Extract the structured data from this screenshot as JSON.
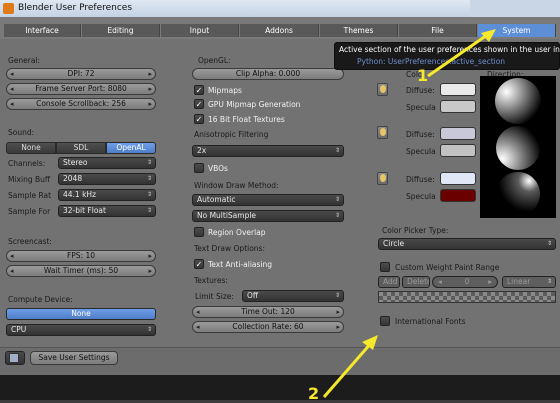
{
  "window": {
    "title": "Blender User Preferences"
  },
  "tabs": [
    {
      "label": "Interface",
      "active": false
    },
    {
      "label": "Editing",
      "active": false
    },
    {
      "label": "Input",
      "active": false
    },
    {
      "label": "Addons",
      "active": false
    },
    {
      "label": "Themes",
      "active": false
    },
    {
      "label": "File",
      "active": false
    },
    {
      "label": "System",
      "active": true
    }
  ],
  "tooltip": {
    "text": "Active section of the user preferences shown in the user interf",
    "python": "Python: UserPreferences.active_section"
  },
  "general": {
    "heading": "General:",
    "dpi": "DPI: 72",
    "frame_server_port": "Frame Server Port: 8080",
    "console_scrollback": "Console Scrollback: 256"
  },
  "sound": {
    "heading": "Sound:",
    "options": [
      "None",
      "SDL",
      "OpenAL"
    ],
    "selected": "OpenAL",
    "channels": {
      "label": "Channels:",
      "value": "Stereo"
    },
    "mixing_buff": {
      "label": "Mixing Buff",
      "value": "2048"
    },
    "sample_rate": {
      "label": "Sample Rat",
      "value": "44.1 kHz"
    },
    "sample_format": {
      "label": "Sample For",
      "value": "32-bit Float"
    }
  },
  "screencast": {
    "heading": "Screencast:",
    "fps": "FPS: 10",
    "wait_timer": "Wait Timer (ms): 50"
  },
  "compute": {
    "heading": "Compute Device:",
    "none_button": "None",
    "device": "CPU"
  },
  "opengl": {
    "heading": "OpenGL:",
    "clip_alpha": "Clip Alpha: 0.000",
    "mipmaps": {
      "label": "Mipmaps",
      "checked": true
    },
    "gpu_mipmap": {
      "label": "GPU Mipmap Generation",
      "checked": true
    },
    "float_textures": {
      "label": "16 Bit Float Textures",
      "checked": true
    },
    "aniso_heading": "Anisotropic Filtering",
    "aniso_value": "2x",
    "vbos": {
      "label": "VBOs",
      "checked": false
    },
    "draw_method_heading": "Window Draw Method:",
    "draw_method": "Automatic",
    "multisample": "No MultiSample",
    "region_overlap": {
      "label": "Region Overlap",
      "checked": false
    },
    "text_draw_heading": "Text Draw Options:",
    "text_antialias": {
      "label": "Text Anti-aliasing",
      "checked": true
    },
    "textures_heading": "Textures:",
    "limit_size_label": "Limit Size:",
    "limit_size_value": "Off",
    "time_out": "Time Out: 120",
    "collection_rate": "Collection Rate: 60"
  },
  "solid_lights": {
    "col_colo": "Colo",
    "col_direction": "Direction:",
    "diffuse_label": "Diffuse:",
    "specular_label": "Specula",
    "lights": [
      {
        "diffuse": "#e9e9e9",
        "specular": "#c8c8c8"
      },
      {
        "diffuse": "#c8c8d8",
        "specular": "#c2c2c2"
      },
      {
        "diffuse": "#e0e6f6",
        "specular": "#6a0000"
      }
    ]
  },
  "color_picker": {
    "heading": "Color Picker Type:",
    "value": "Circle"
  },
  "weight_paint": {
    "label": "Custom Weight Paint Range",
    "checked": false,
    "add": "Add",
    "delete": "Delete",
    "index": "0",
    "interp": "Linear"
  },
  "international_fonts": {
    "label": "International Fonts",
    "checked": false
  },
  "bottom": {
    "save_button": "Save User Settings"
  },
  "callouts": {
    "one": "1",
    "two": "2"
  },
  "colors": {
    "accent": "#5d8fd9",
    "panel": "#727272",
    "callout": "#f6e82a"
  }
}
